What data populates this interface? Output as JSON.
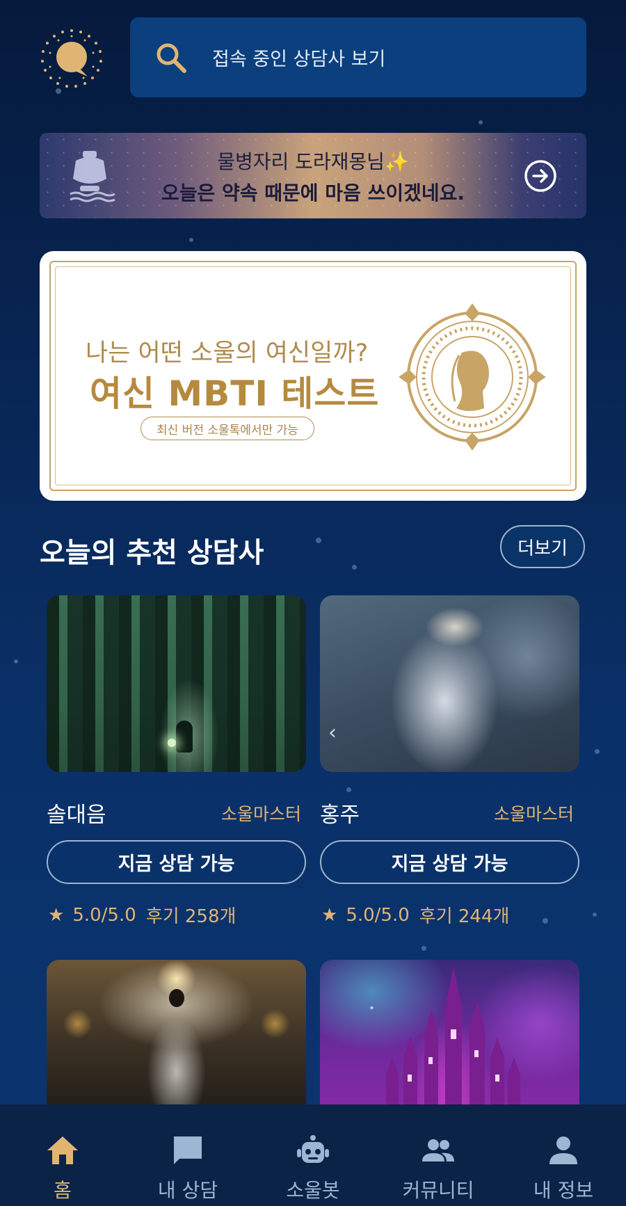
{
  "header": {
    "logo_icon": "speech-bubble-logo",
    "search_placeholder": "접속 중인 상담사 보기",
    "search_icon": "search-icon"
  },
  "horoscope": {
    "line1": "물병자리 도라재몽님",
    "line1_sparkle": "✨",
    "line2": "오늘은 약속 때문에 마음 쓰이겠네요.",
    "zodiac_icon": "aquarius-icon",
    "arrow_icon": "arrow-right-circle-icon"
  },
  "promo": {
    "question": "나는 어떤 소울의 여신일까?",
    "title": "여신 MBTI 테스트",
    "pill": "최신 버전 소울톡에서만 가능"
  },
  "section": {
    "title": "오늘의 추천 상담사",
    "more": "더보기"
  },
  "counselors": [
    {
      "name": "솔대음",
      "grade": "소울마스터",
      "status": "지금 상담 가능",
      "star": "★",
      "rating": "5.0/5.0",
      "reviews": "후기 258개",
      "image": "forest-girl-image"
    },
    {
      "name": "홍주",
      "grade": "소울마스터",
      "status": "지금 상담 가능",
      "star": "★",
      "rating": "5.0/5.0",
      "reviews": "후기 244개",
      "image": "white-angel-image"
    },
    {
      "name": "",
      "image": "golden-angel-image"
    },
    {
      "name": "",
      "image": "purple-castle-image"
    }
  ],
  "nav": [
    {
      "label": "홈",
      "icon": "home-icon",
      "active": true
    },
    {
      "label": "내 상담",
      "icon": "chat-icon",
      "active": false
    },
    {
      "label": "소울봇",
      "icon": "robot-icon",
      "active": false
    },
    {
      "label": "커뮤니티",
      "icon": "people-icon",
      "active": false
    },
    {
      "label": "내 정보",
      "icon": "person-icon",
      "active": false
    }
  ],
  "colors": {
    "background": "#082553",
    "accent_gold": "#e0b574",
    "search_bg": "#0b3f7e",
    "nav_bg": "#0a2347",
    "nav_inactive": "#9db6d3"
  }
}
